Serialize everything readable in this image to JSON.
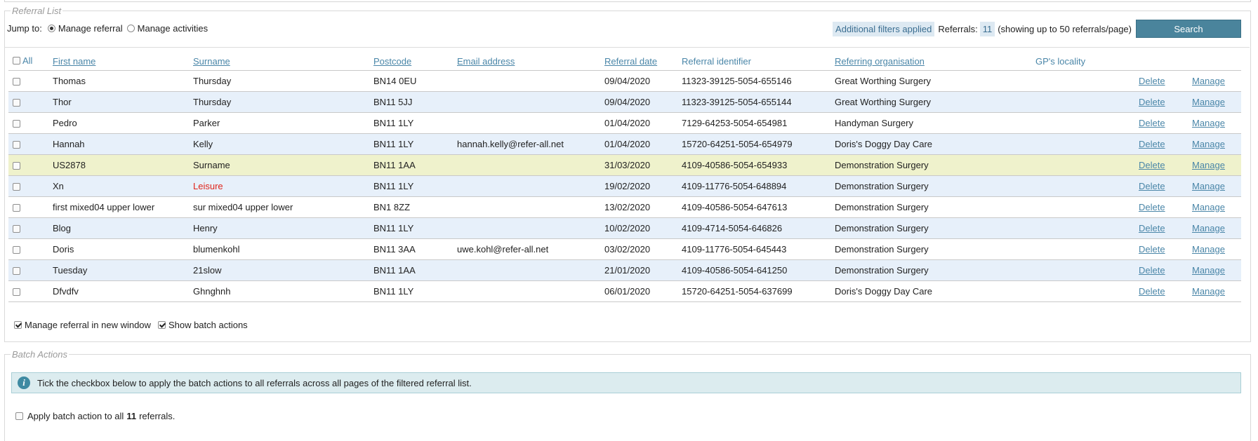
{
  "referral_list": {
    "legend": "Referral List",
    "jump_label": "Jump to:",
    "jump_options": [
      {
        "label": "Manage referral",
        "selected": true
      },
      {
        "label": "Manage activities",
        "selected": false
      }
    ],
    "filters_chip": "Additional filters applied",
    "referrals_label": "Referrals:",
    "referrals_count": "11",
    "showing_text": "(showing up to 50 referrals/page)",
    "search_label": "Search",
    "columns": {
      "all": "All",
      "first_name": "First name",
      "surname": "Surname",
      "postcode": "Postcode",
      "email": "Email address",
      "referral_date": "Referral date",
      "referral_id": "Referral identifier",
      "organisation": "Referring organisation",
      "locality": "GP's locality"
    },
    "rows": [
      {
        "first": "Thomas",
        "surname": "Thursday",
        "postcode": "BN14 0EU",
        "email": "",
        "date": "09/04/2020",
        "id": "11323-39125-5054-655146",
        "org": "Great Worthing Surgery",
        "locality": "",
        "delete": "Delete",
        "manage": "Manage"
      },
      {
        "first": "Thor",
        "surname": "Thursday",
        "postcode": "BN11 5JJ",
        "email": "",
        "date": "09/04/2020",
        "id": "11323-39125-5054-655144",
        "org": "Great Worthing Surgery",
        "locality": "",
        "delete": "Delete",
        "manage": "Manage"
      },
      {
        "first": "Pedro",
        "surname": "Parker",
        "postcode": "BN11 1LY",
        "email": "",
        "date": "01/04/2020",
        "id": "7129-64253-5054-654981",
        "org": "Handyman Surgery",
        "locality": "",
        "delete": "Delete",
        "manage": "Manage"
      },
      {
        "first": "Hannah",
        "surname": "Kelly",
        "postcode": "BN11 1LY",
        "email": "hannah.kelly@refer-all.net",
        "date": "01/04/2020",
        "id": "15720-64251-5054-654979",
        "org": "Doris's Doggy Day Care",
        "locality": "",
        "delete": "Delete",
        "manage": "Manage"
      },
      {
        "first": "US2878",
        "surname": "Surname",
        "postcode": "BN11 1AA",
        "email": "",
        "date": "31/03/2020",
        "id": "4109-40586-5054-654933",
        "org": "Demonstration Surgery",
        "locality": "",
        "delete": "Delete",
        "manage": "Manage"
      },
      {
        "first": "Xn",
        "surname": "Leisure",
        "postcode": "BN11 1LY",
        "email": "",
        "date": "19/02/2020",
        "id": "4109-11776-5054-648894",
        "org": "Demonstration Surgery",
        "locality": "",
        "delete": "Delete",
        "manage": "Manage"
      },
      {
        "first": "first mixed04 upper lower",
        "surname": "sur mixed04 upper lower",
        "postcode": "BN1 8ZZ",
        "email": "",
        "date": "13/02/2020",
        "id": "4109-40586-5054-647613",
        "org": "Demonstration Surgery",
        "locality": "",
        "delete": "Delete",
        "manage": "Manage"
      },
      {
        "first": "Blog",
        "surname": "Henry",
        "postcode": "BN11 1LY",
        "email": "",
        "date": "10/02/2020",
        "id": "4109-4714-5054-646826",
        "org": "Demonstration Surgery",
        "locality": "",
        "delete": "Delete",
        "manage": "Manage"
      },
      {
        "first": "Doris",
        "surname": "blumenkohl",
        "postcode": "BN11 3AA",
        "email": "uwe.kohl@refer-all.net",
        "date": "03/02/2020",
        "id": "4109-11776-5054-645443",
        "org": "Demonstration Surgery",
        "locality": "",
        "delete": "Delete",
        "manage": "Manage"
      },
      {
        "first": "Tuesday",
        "surname": "21slow",
        "postcode": "BN11 1AA",
        "email": "",
        "date": "21/01/2020",
        "id": "4109-40586-5054-641250",
        "org": "Demonstration Surgery",
        "locality": "",
        "delete": "Delete",
        "manage": "Manage"
      },
      {
        "first": "Dfvdfv",
        "surname": "Ghnghnh",
        "postcode": "BN11 1LY",
        "email": "",
        "date": "06/01/2020",
        "id": "15720-64251-5054-637699",
        "org": "Doris's Doggy Day Care",
        "locality": "",
        "delete": "Delete",
        "manage": "Manage"
      }
    ],
    "options": [
      {
        "label": "Manage referral in new window",
        "checked": true
      },
      {
        "label": "Show batch actions",
        "checked": true
      }
    ]
  },
  "batch_actions": {
    "legend": "Batch Actions",
    "info_text": "Tick the checkbox below to apply the batch actions to all referrals across all pages of the filtered referral list.",
    "apply_prefix": "Apply batch action to all",
    "apply_count": "11",
    "apply_suffix": "referrals."
  },
  "colors": {
    "accent": "#4a849c",
    "link": "#4a86a8",
    "row_alt": "#e7f0fa",
    "row_highlight": "#eff2cc",
    "alert_text": "#e0251b"
  }
}
